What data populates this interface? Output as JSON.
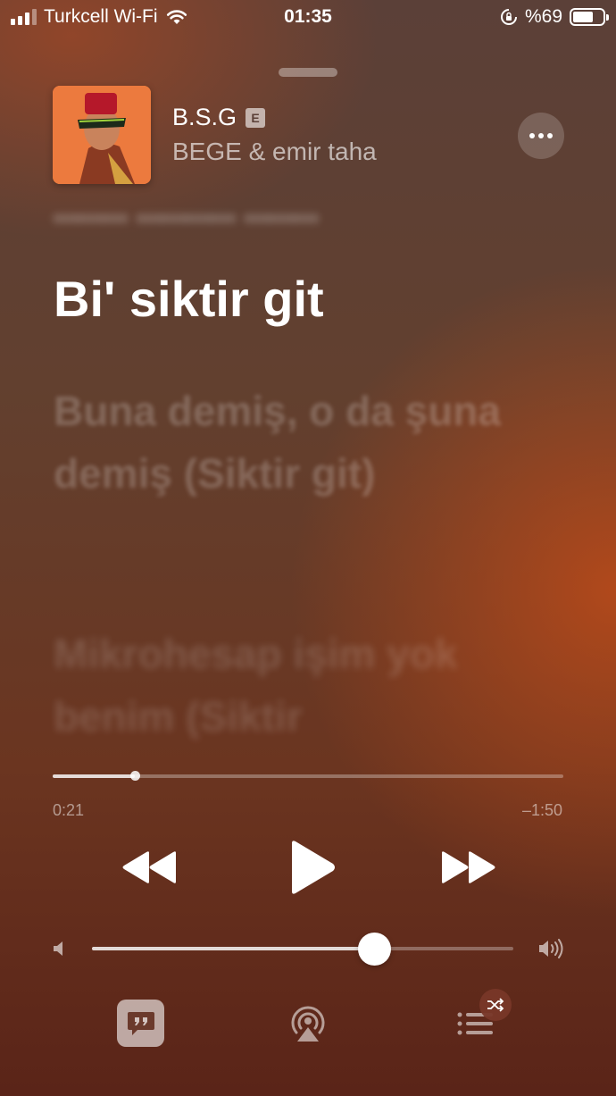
{
  "status_bar": {
    "carrier": "Turkcell Wi-Fi",
    "time": "01:35",
    "battery_text": "%69",
    "battery_level": 0.69
  },
  "now_playing": {
    "title": "B.S.G",
    "explicit_badge": "E",
    "artist": "BEGE & emir taha"
  },
  "lyrics": {
    "current": "Bi' siktir git",
    "next_1": "Buna demiş, o da şuna demiş (Siktir git)",
    "next_2": "Mikrohesap işim yok benim (Siktir"
  },
  "playback": {
    "elapsed": "0:21",
    "remaining": "–1:50",
    "progress_fraction": 0.16
  },
  "volume": {
    "level_fraction": 0.67
  },
  "icons": {
    "more": "ellipsis-icon",
    "rewind": "rewind-icon",
    "play": "play-icon",
    "forward": "fast-forward-icon",
    "lyrics": "lyrics-quote-icon",
    "airplay": "airplay-icon",
    "queue": "queue-list-icon",
    "shuffle": "shuffle-icon"
  },
  "colors": {
    "accent_white": "#ffffff",
    "background_top": "#5b4038",
    "background_bottom": "#5a2418"
  }
}
